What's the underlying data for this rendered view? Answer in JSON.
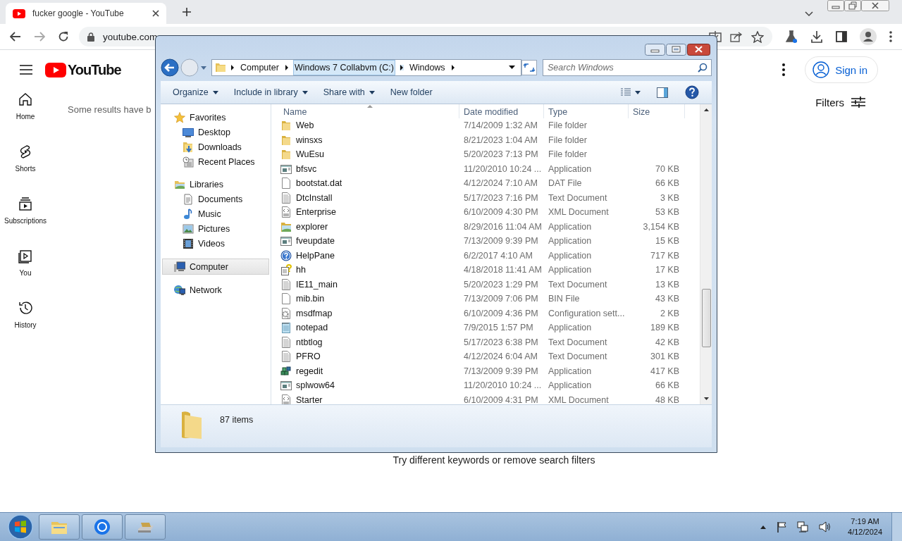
{
  "browser": {
    "tab": {
      "title": "fucker google - YouTube"
    },
    "url": "youtube.com"
  },
  "youtube": {
    "logo": "YouTube",
    "rail": [
      {
        "label": "Home"
      },
      {
        "label": "Shorts"
      },
      {
        "label": "Subscriptions"
      },
      {
        "label": "You"
      },
      {
        "label": "History"
      }
    ],
    "notice": "Some results have b",
    "sign_in": "Sign in",
    "filters": "Filters",
    "hint": "Try different keywords or remove search filters"
  },
  "explorer": {
    "breadcrumbs": [
      {
        "label": "Computer",
        "hovered": false
      },
      {
        "label": "Windows 7 Collabvm (C:)",
        "hovered": true
      },
      {
        "label": "Windows",
        "hovered": false
      }
    ],
    "search": {
      "placeholder": "Search Windows"
    },
    "toolbar": [
      {
        "label": "Organize",
        "dropdown": true
      },
      {
        "label": "Include in library",
        "dropdown": true
      },
      {
        "label": "Share with",
        "dropdown": true
      },
      {
        "label": "New folder",
        "dropdown": false
      }
    ],
    "nav": [
      {
        "label": "Favorites",
        "selected": false,
        "children": [
          {
            "label": "Desktop",
            "selected": false
          },
          {
            "label": "Downloads",
            "selected": false
          },
          {
            "label": "Recent Places",
            "selected": false
          }
        ]
      },
      {
        "label": "Libraries",
        "selected": false,
        "children": [
          {
            "label": "Documents",
            "selected": false
          },
          {
            "label": "Music",
            "selected": false
          },
          {
            "label": "Pictures",
            "selected": false
          },
          {
            "label": "Videos",
            "selected": false
          }
        ]
      },
      {
        "label": "Computer",
        "selected": true
      },
      {
        "label": "Network",
        "selected": false
      }
    ],
    "columns": [
      "Name",
      "Date modified",
      "Type",
      "Size"
    ],
    "rows": [
      {
        "kind": "folder",
        "name": "Web",
        "date": "7/14/2009 1:32 AM",
        "type": "File folder",
        "size": ""
      },
      {
        "kind": "folder",
        "name": "winsxs",
        "date": "8/21/2023 1:04 AM",
        "type": "File folder",
        "size": ""
      },
      {
        "kind": "folder",
        "name": "WuEsu",
        "date": "5/20/2023 7:13 PM",
        "type": "File folder",
        "size": ""
      },
      {
        "kind": "app",
        "name": "bfsvc",
        "date": "11/20/2010 10:24 ...",
        "type": "Application",
        "size": "70 KB"
      },
      {
        "kind": "blank",
        "name": "bootstat.dat",
        "date": "4/12/2024 7:10 AM",
        "type": "DAT File",
        "size": "66 KB"
      },
      {
        "kind": "text",
        "name": "DtcInstall",
        "date": "5/17/2023 7:16 PM",
        "type": "Text Document",
        "size": "3 KB"
      },
      {
        "kind": "xml",
        "name": "Enterprise",
        "date": "6/10/2009 4:30 PM",
        "type": "XML Document",
        "size": "53 KB"
      },
      {
        "kind": "explorer",
        "name": "explorer",
        "date": "8/29/2016 11:04 AM",
        "type": "Application",
        "size": "3,154 KB"
      },
      {
        "kind": "app",
        "name": "fveupdate",
        "date": "7/13/2009 9:39 PM",
        "type": "Application",
        "size": "15 KB"
      },
      {
        "kind": "help",
        "name": "HelpPane",
        "date": "6/2/2017 4:10 AM",
        "type": "Application",
        "size": "717 KB"
      },
      {
        "kind": "helpdoc",
        "name": "hh",
        "date": "4/18/2018 11:41 AM",
        "type": "Application",
        "size": "17 KB"
      },
      {
        "kind": "text",
        "name": "IE11_main",
        "date": "5/20/2023 1:29 PM",
        "type": "Text Document",
        "size": "13 KB"
      },
      {
        "kind": "blank",
        "name": "mib.bin",
        "date": "7/13/2009 7:06 PM",
        "type": "BIN File",
        "size": "43 KB"
      },
      {
        "kind": "config",
        "name": "msdfmap",
        "date": "6/10/2009 4:36 PM",
        "type": "Configuration sett...",
        "size": "2 KB"
      },
      {
        "kind": "notepad",
        "name": "notepad",
        "date": "7/9/2015 1:57 PM",
        "type": "Application",
        "size": "189 KB"
      },
      {
        "kind": "text",
        "name": "ntbtlog",
        "date": "5/17/2023 6:38 PM",
        "type": "Text Document",
        "size": "42 KB"
      },
      {
        "kind": "text",
        "name": "PFRO",
        "date": "4/12/2024 6:04 AM",
        "type": "Text Document",
        "size": "301 KB"
      },
      {
        "kind": "regedit",
        "name": "regedit",
        "date": "7/13/2009 9:39 PM",
        "type": "Application",
        "size": "417 KB"
      },
      {
        "kind": "app",
        "name": "splwow64",
        "date": "11/20/2010 10:24 ...",
        "type": "Application",
        "size": "66 KB"
      },
      {
        "kind": "xml",
        "name": "Starter",
        "date": "6/10/2009 4:31 PM",
        "type": "XML Document",
        "size": "48 KB"
      }
    ],
    "status": "87 items"
  },
  "taskbar": {
    "time": "7:19 AM",
    "date": "4/12/2024"
  }
}
